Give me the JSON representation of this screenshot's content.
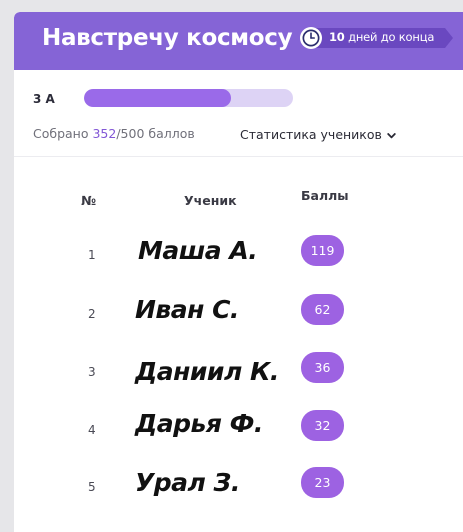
{
  "header": {
    "title": "Навстречу космосу",
    "timer_days": "10",
    "timer_text": "дней до конца",
    "icon": "clock-icon"
  },
  "class_progress": {
    "class_name": "3 А",
    "collected_prefix": "Собрано ",
    "collected_value": "352",
    "collected_suffix": "/500 баллов",
    "progress_fraction": 0.704,
    "stats_label": "Статистика учеников",
    "stats_icon": "chevron-down-icon"
  },
  "table": {
    "headers": {
      "num": "№",
      "student": "Ученик",
      "points": "Баллы"
    },
    "rows": [
      {
        "num": "1",
        "name": "Маша А.",
        "points": "119"
      },
      {
        "num": "2",
        "name": "Иван С.",
        "points": "62"
      },
      {
        "num": "3",
        "name": "Даниил К.",
        "points": "36"
      },
      {
        "num": "4",
        "name": "Дарья Ф.",
        "points": "32"
      },
      {
        "num": "5",
        "name": "Урал З.",
        "points": "23"
      }
    ]
  },
  "colors": {
    "header_bg": "#8564d6",
    "accent": "#8257d6",
    "progress_fill": "#9a6ae9",
    "progress_track": "#ddd3f5",
    "badge": "#9d62e2"
  }
}
